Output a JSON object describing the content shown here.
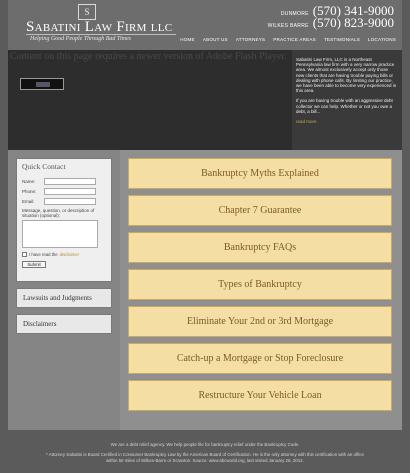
{
  "header": {
    "logo_glyph": "S",
    "firm_name": "Sabatini Law Firm llc",
    "tagline": "Helping Good People Through Bad Times",
    "phones": [
      {
        "city": "DUNMORE",
        "number": "(570) 341-9000"
      },
      {
        "city": "WILKES BARRE",
        "number": "(570) 823-9000"
      }
    ]
  },
  "nav": [
    "HOME",
    "ABOUT US",
    "ATTORNEYS",
    "PRACTICE AREAS",
    "TESTIMONIALS",
    "LOCATIONS"
  ],
  "flash": {
    "message": "Content on this page requires a newer version of Adobe Flash Player."
  },
  "intro": {
    "paragraph_1": "Sabatini Law Firm, LLC is a Northeast Pennsylvania law firm with a very narrow practice area. We almost exclusively accept only those new clients that are having trouble paying bills or dealing with phone calls. By limiting our practice, we have been able to become very experienced in this area.",
    "paragraph_2": "If you are having trouble with an aggressive debt collector we can help. Whether or not you owe a debt, a bill...",
    "read_more": "read more"
  },
  "contact": {
    "title": "Quick Contact",
    "fields": [
      {
        "label": "Name:"
      },
      {
        "label": "Phone:"
      },
      {
        "label": "Email:"
      }
    ],
    "message_label": "Message, question, or description of situation (optional):",
    "agree_prefix": "I have read the",
    "agree_link": "disclaimer",
    "submit": "Submit"
  },
  "side_panels": [
    "Lawsuits and Judgments",
    "Disclaimers"
  ],
  "links": [
    "Bankruptcy Myths Explained",
    "Chapter 7 Guarantee",
    "Bankruptcy FAQs",
    "Types of Bankruptcy",
    "Eliminate Your 2nd or 3rd Mortgage",
    "Catch-up a Mortgage or Stop Foreclosure",
    "Restructure Your Vehicle Loan"
  ],
  "footer": {
    "line_1": "We are a debt relief agency. We help people file for bankruptcy relief under the Bankruptcy Code.",
    "line_2": "* Attorney Sabatini is Board Certified in Consumer Bankruptcy Law by the American Board of Certification. He is the only attorney with this certification with an office within 50 miles of Wilkes-Barre or Scranton. Source: www.abcworld.org, last visited January 26, 2012."
  },
  "colors": {
    "link_box_fill": "#f5dea3",
    "link_text": "#7a5a2a",
    "accent_gold": "#c8a84f"
  }
}
